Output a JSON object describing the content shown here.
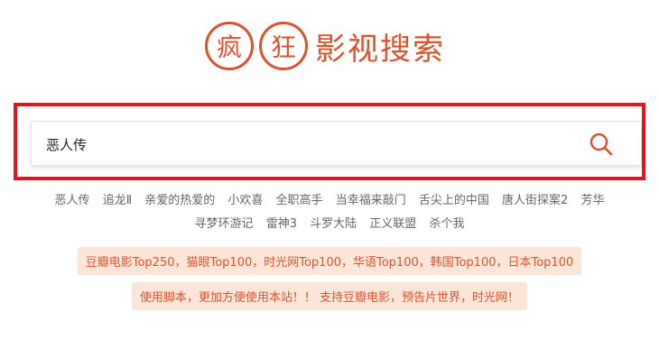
{
  "logo": {
    "char1": "疯",
    "char2": "狂",
    "text": "影视搜索"
  },
  "search": {
    "value": "恶人传",
    "placeholder": ""
  },
  "tags": {
    "row1": [
      "恶人传",
      "追龙Ⅱ",
      "亲爱的热爱的",
      "小欢喜",
      "全职高手",
      "当幸福来敲门",
      "舌尖上的中国",
      "唐人街探案2",
      "芳华"
    ],
    "row2": [
      "寻梦环游记",
      "雷神3",
      "斗罗大陆",
      "正义联盟",
      "杀个我"
    ]
  },
  "notices": {
    "ranking": "豆瓣电影Top250，猫眼Top100，时光网Top100，华语Top100，韩国Top100，日本Top100",
    "script": "使用脚本，更加方便使用本站！！ 支持豆瓣电影，预告片世界，时光网！"
  },
  "colors": {
    "brand": "#d9532f",
    "highlight": "#e2141d",
    "notice_bg": "#fde6d8"
  }
}
